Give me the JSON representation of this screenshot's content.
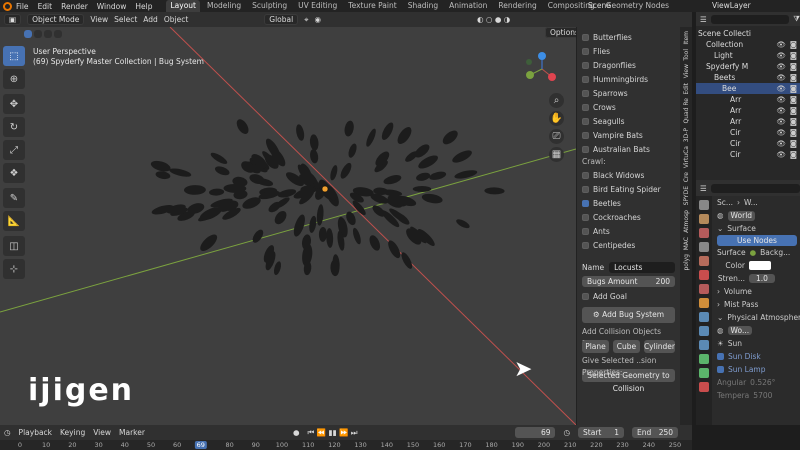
{
  "menu": {
    "items": [
      "File",
      "Edit",
      "Render",
      "Window",
      "Help"
    ],
    "workspaces": [
      "Layout",
      "Modeling",
      "Sculpting",
      "UV Editing",
      "Texture Paint",
      "Shading",
      "Animation",
      "Rendering",
      "Compositing",
      "Geometry Nodes"
    ],
    "active_workspace": "Layout",
    "scene": "Scene",
    "view_layer": "ViewLayer"
  },
  "viewport_header": {
    "mode": "Object Mode",
    "view": "View",
    "select": "Select",
    "add": "Add",
    "object": "Object",
    "transform": "Global",
    "options": "Options"
  },
  "viewport": {
    "overlay_title": "User Perspective",
    "overlay_subtitle": "(69) Spyderfy Master Collection | Bug System",
    "watermark": "ijigen"
  },
  "npanel": {
    "fly_items": [
      {
        "label": "Butterflies",
        "checked": false
      },
      {
        "label": "Flies",
        "checked": false
      },
      {
        "label": "Dragonflies",
        "checked": false
      },
      {
        "label": "Hummingbirds",
        "checked": false
      },
      {
        "label": "Sparrows",
        "checked": false
      },
      {
        "label": "Crows",
        "checked": false
      },
      {
        "label": "Seagulls",
        "checked": false
      },
      {
        "label": "Vampire Bats",
        "checked": false
      },
      {
        "label": "Australian Bats",
        "checked": false
      }
    ],
    "crawl_label": "Crawl:",
    "crawl_items": [
      {
        "label": "Black Widows",
        "checked": false
      },
      {
        "label": "Bird Eating Spider",
        "checked": false
      },
      {
        "label": "Beetles",
        "checked": true
      },
      {
        "label": "Cockroaches",
        "checked": false
      },
      {
        "label": "Ants",
        "checked": false
      },
      {
        "label": "Centipedes",
        "checked": false
      }
    ],
    "name_label": "Name",
    "name_value": "Locusts",
    "bugs_amount_label": "Bugs Amount",
    "bugs_amount_value": "200",
    "add_goal": "Add Goal",
    "add_bug_system": "Add Bug System",
    "collision_label": "Add Collision Objects Below:",
    "collision_buttons": [
      "Plane",
      "Cube",
      "Cylinder"
    ],
    "give_selected": "Give Selected ..sion Properties:",
    "selected_geometry": "Selected Geometry to Collision"
  },
  "vertical_tabs": [
    "Item",
    "Tool",
    "View",
    "Edit",
    "Quad Re",
    "3D-P",
    "VirtuCa",
    "Cre",
    "SPYDE",
    "Atmosp",
    "MAC",
    "polyg"
  ],
  "outliner": {
    "rows": [
      "Scene Collecti",
      "Collection",
      "Light",
      "Spyderfy M",
      "Beets",
      "Bee",
      "Arr",
      "Arr",
      "Arr",
      "Cir",
      "Cir",
      "Cir"
    ]
  },
  "properties": {
    "breadcrumb_scene": "Sc...",
    "breadcrumb_world": "W...",
    "world_name": "World",
    "surface_section": "Surface",
    "use_nodes": "Use Nodes",
    "surface_label": "Surface",
    "surface_value": "Backg...",
    "color_label": "Color",
    "strength_label": "Stren...",
    "strength_value": "1.0",
    "volume_section": "Volume",
    "mist_section": "Mist Pass",
    "physical_atmos": "Physical Atmospher",
    "world_sub": "Wo...",
    "sun_section": "Sun",
    "sun_disk": "Sun Disk",
    "sun_lamp": "Sun Lamp",
    "angular": "Angular",
    "angular_value": "0.526°",
    "temperature": "Tempera",
    "temperature_value": "5700"
  },
  "timeline": {
    "playback": "Playback",
    "keying": "Keying",
    "view": "View",
    "marker": "Marker",
    "current_frame": "69",
    "start_label": "Start",
    "start_value": "1",
    "end_label": "End",
    "end_value": "250",
    "ticks": [
      "0",
      "10",
      "20",
      "30",
      "40",
      "50",
      "60",
      "69",
      "80",
      "90",
      "100",
      "110",
      "120",
      "130",
      "140",
      "150",
      "160",
      "170",
      "180",
      "190",
      "200",
      "210",
      "220",
      "230",
      "240",
      "250"
    ]
  },
  "colors": {
    "accent": "#4772b3",
    "background": "#3f3f3f",
    "x_axis": "#c0504d",
    "y_axis": "#7ba23f"
  }
}
